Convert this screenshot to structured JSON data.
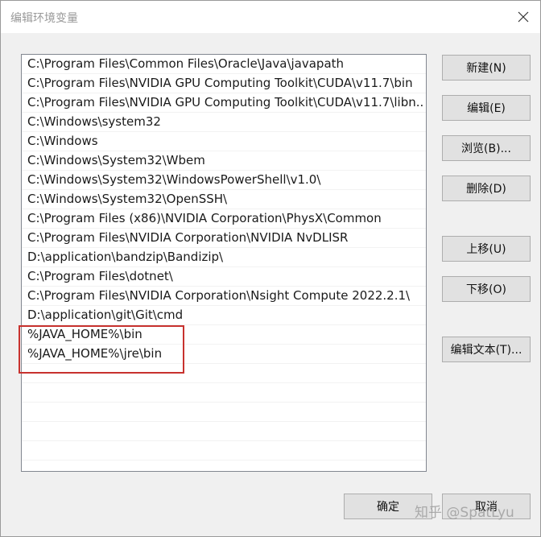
{
  "window": {
    "title": "编辑环境变量"
  },
  "paths": [
    "C:\\Program Files\\Common Files\\Oracle\\Java\\javapath",
    "C:\\Program Files\\NVIDIA GPU Computing Toolkit\\CUDA\\v11.7\\bin",
    "C:\\Program Files\\NVIDIA GPU Computing Toolkit\\CUDA\\v11.7\\libn...",
    "C:\\Windows\\system32",
    "C:\\Windows",
    "C:\\Windows\\System32\\Wbem",
    "C:\\Windows\\System32\\WindowsPowerShell\\v1.0\\",
    "C:\\Windows\\System32\\OpenSSH\\",
    "C:\\Program Files (x86)\\NVIDIA Corporation\\PhysX\\Common",
    "C:\\Program Files\\NVIDIA Corporation\\NVIDIA NvDLISR",
    "D:\\application\\bandzip\\Bandizip\\",
    "C:\\Program Files\\dotnet\\",
    "C:\\Program Files\\NVIDIA Corporation\\Nsight Compute 2022.2.1\\",
    "D:\\application\\git\\Git\\cmd",
    "%JAVA_HOME%\\bin",
    "%JAVA_HOME%\\jre\\bin"
  ],
  "buttons": {
    "new": "新建(N)",
    "edit": "编辑(E)",
    "browse": "浏览(B)...",
    "delete": "删除(D)",
    "move_up": "上移(U)",
    "move_down": "下移(O)",
    "edit_text": "编辑文本(T)...",
    "ok": "确定",
    "cancel": "取消"
  },
  "watermark": "知乎 @SpatLyu",
  "colors": {
    "highlight_border": "#c8322e"
  }
}
